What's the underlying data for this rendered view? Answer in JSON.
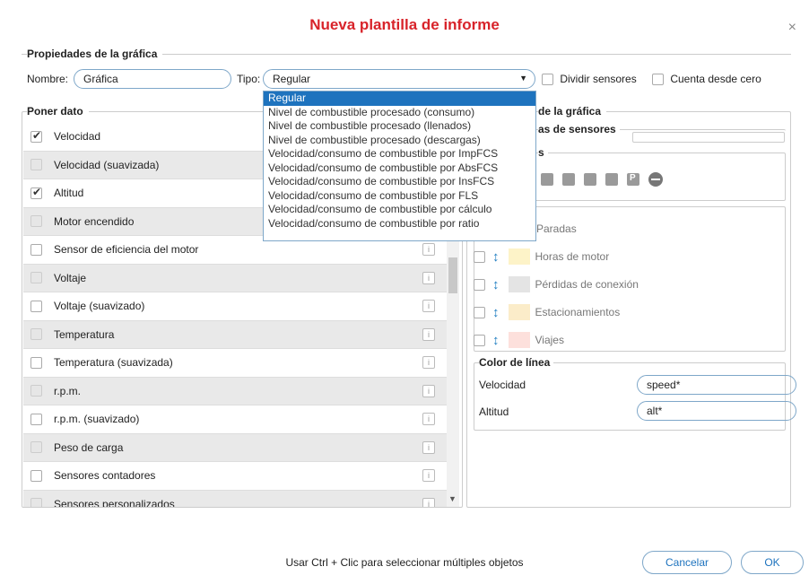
{
  "dialog": {
    "title": "Nueva plantilla de informe",
    "close": "×"
  },
  "props": {
    "legend": "Propiedades de la gráfica",
    "name_label": "Nombre:",
    "name_value": "Gráfica",
    "type_label": "Tipo:",
    "type_value": "Regular",
    "split_label": "Dividir sensores",
    "count_zero_label": "Cuenta desde cero"
  },
  "dropdown": {
    "options": [
      "Regular",
      "Nivel de combustible procesado (consumo)",
      "Nivel de combustible procesado (llenados)",
      "Nivel de combustible procesado (descargas)",
      "Velocidad/consumo de combustible por ImpFCS",
      "Velocidad/consumo de combustible por AbsFCS",
      "Velocidad/consumo de combustible por InsFCS",
      "Velocidad/consumo de combustible por FLS",
      "Velocidad/consumo de combustible por cálculo",
      "Velocidad/consumo de combustible por ratio"
    ],
    "selected": 0
  },
  "data_panel": {
    "legend": "Poner dato",
    "items": [
      {
        "label": "Velocidad",
        "checked": true
      },
      {
        "label": "Velocidad (suavizada)",
        "checked": false
      },
      {
        "label": "Altitud",
        "checked": true
      },
      {
        "label": "Motor encendido",
        "checked": false
      },
      {
        "label": "Sensor de eficiencia del motor",
        "checked": false
      },
      {
        "label": "Voltaje",
        "checked": false
      },
      {
        "label": "Voltaje (suavizado)",
        "checked": false
      },
      {
        "label": "Temperatura",
        "checked": false
      },
      {
        "label": "Temperatura (suavizada)",
        "checked": false
      },
      {
        "label": "r.p.m.",
        "checked": false
      },
      {
        "label": "r.p.m. (suavizado)",
        "checked": false
      },
      {
        "label": "Peso de carga",
        "checked": false
      },
      {
        "label": "Sensores contadores",
        "checked": false
      },
      {
        "label": "Sensores personalizados",
        "checked": false
      }
    ]
  },
  "right_panel": {
    "legend": "de la gráfica",
    "sensors_legend": "as de sensores",
    "markers_legend": "s",
    "marker_icons": [
      "fuel-icon",
      "flag-icon",
      "image-icon",
      "video-icon",
      "parking-icon",
      "stop-icon"
    ],
    "marker_letters": {
      "parking": "P"
    },
    "events": [
      {
        "label": "Paradas",
        "color": ""
      },
      {
        "label": "Horas de motor",
        "color": "#fdf3c8"
      },
      {
        "label": "Pérdidas de conexión",
        "color": "#e4e4e4"
      },
      {
        "label": "Estacionamientos",
        "color": "#fbecc9"
      },
      {
        "label": "Viajes",
        "color": "#fde0dc"
      }
    ],
    "line_color_legend": "Color de línea",
    "line_colors": [
      {
        "label": "Velocidad",
        "value": "speed*"
      },
      {
        "label": "Altitud",
        "value": "alt*"
      }
    ]
  },
  "footer": {
    "hint": "Usar Ctrl + Clic para seleccionar múltiples objetos",
    "cancel": "Cancelar",
    "ok": "OK"
  },
  "colors": {
    "title": "#d8232a",
    "accent": "#1e73be"
  }
}
